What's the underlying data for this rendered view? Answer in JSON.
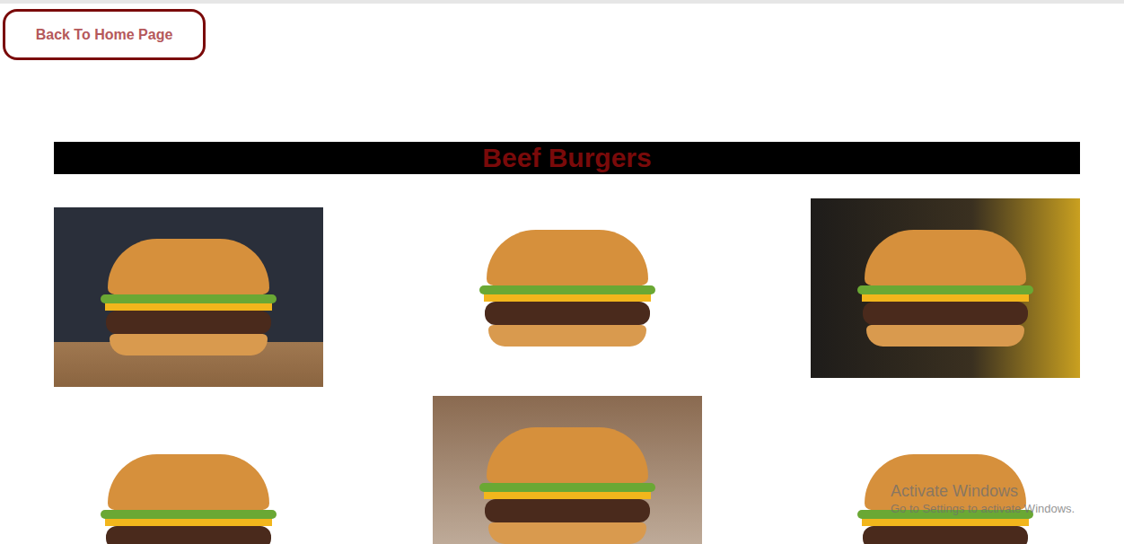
{
  "back_button": {
    "label": "Back To Home Page"
  },
  "heading": "Beef Burgers",
  "photos": [
    {},
    {},
    {},
    {},
    {},
    {}
  ],
  "watermark": {
    "title": "Activate Windows",
    "subtitle": "Go to Settings to activate Windows."
  }
}
